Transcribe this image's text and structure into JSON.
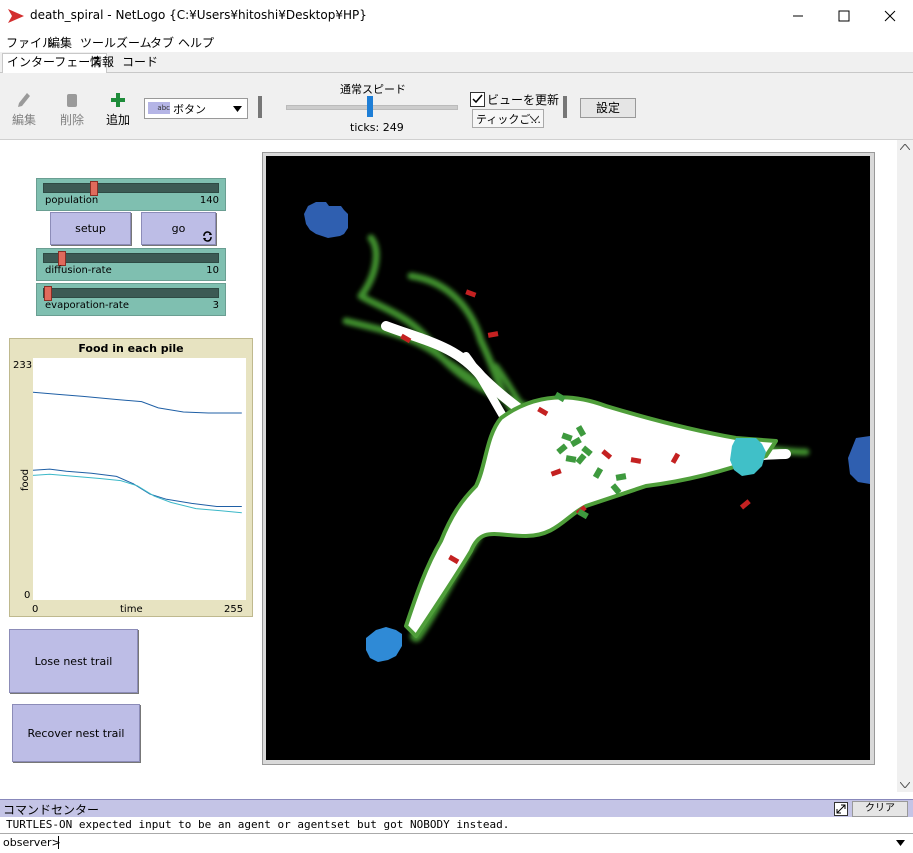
{
  "window": {
    "title": "death_spiral - NetLogo {C:¥Users¥hitoshi¥Desktop¥HP}",
    "accent_color": "#d32f2f"
  },
  "menu": [
    "ファイル",
    "編集",
    "ツール",
    "ズーム",
    "タブ",
    "ヘルプ"
  ],
  "tabs": [
    "インターフェース",
    "情報",
    "コード"
  ],
  "toolbar": {
    "edit_label": "編集",
    "delete_label": "削除",
    "add_label": "追加",
    "widget_type": "ボタン",
    "speed_label": "通常スピード",
    "ticks_label": "ticks: 249",
    "update_view_label": "ビューを更新",
    "update_view_checked": true,
    "update_mode": "ティックご...",
    "settings_label": "設定"
  },
  "widgets": {
    "population": {
      "label": "population",
      "value": "140",
      "fraction": 0.28
    },
    "setup_label": "setup",
    "go_label": "go",
    "diffusion": {
      "label": "diffusion-rate",
      "value": "10",
      "fraction": 0.1
    },
    "evaporation": {
      "label": "evaporation-rate",
      "value": "3",
      "fraction": 0.03
    },
    "lose_label": "Lose nest trail",
    "recover_label": "Recover nest trail"
  },
  "chart_data": {
    "type": "line",
    "title": "Food in each pile",
    "xlabel": "time",
    "ylabel": "food",
    "xlim": [
      0,
      255
    ],
    "ylim": [
      0,
      233
    ],
    "x_ticks": [
      "0",
      "255"
    ],
    "y_ticks": [
      "0",
      "233"
    ],
    "series": [
      {
        "color": "#1f5fa5",
        "points": [
          [
            0,
            200
          ],
          [
            30,
            198
          ],
          [
            60,
            196
          ],
          [
            100,
            193
          ],
          [
            130,
            191
          ],
          [
            150,
            185
          ],
          [
            180,
            181
          ],
          [
            210,
            180
          ],
          [
            250,
            180
          ]
        ]
      },
      {
        "color": "#1f5fa5",
        "points": [
          [
            0,
            125
          ],
          [
            20,
            126
          ],
          [
            40,
            124
          ],
          [
            70,
            122
          ],
          [
            100,
            119
          ],
          [
            120,
            112
          ],
          [
            140,
            102
          ],
          [
            160,
            97
          ],
          [
            190,
            93
          ],
          [
            220,
            90
          ],
          [
            250,
            90
          ]
        ]
      },
      {
        "color": "#3cb8c8",
        "points": [
          [
            0,
            120
          ],
          [
            20,
            121
          ],
          [
            50,
            119
          ],
          [
            80,
            117
          ],
          [
            105,
            115
          ],
          [
            125,
            110
          ],
          [
            145,
            100
          ],
          [
            165,
            94
          ],
          [
            195,
            88
          ],
          [
            225,
            86
          ],
          [
            250,
            84
          ]
        ]
      }
    ]
  },
  "command_center": {
    "title": "コマンドセンター",
    "clear_label": "クリア",
    "output": "TURTLES-ON expected input to be an agent or agentset but got NOBODY instead.",
    "prompt": "observer>"
  }
}
